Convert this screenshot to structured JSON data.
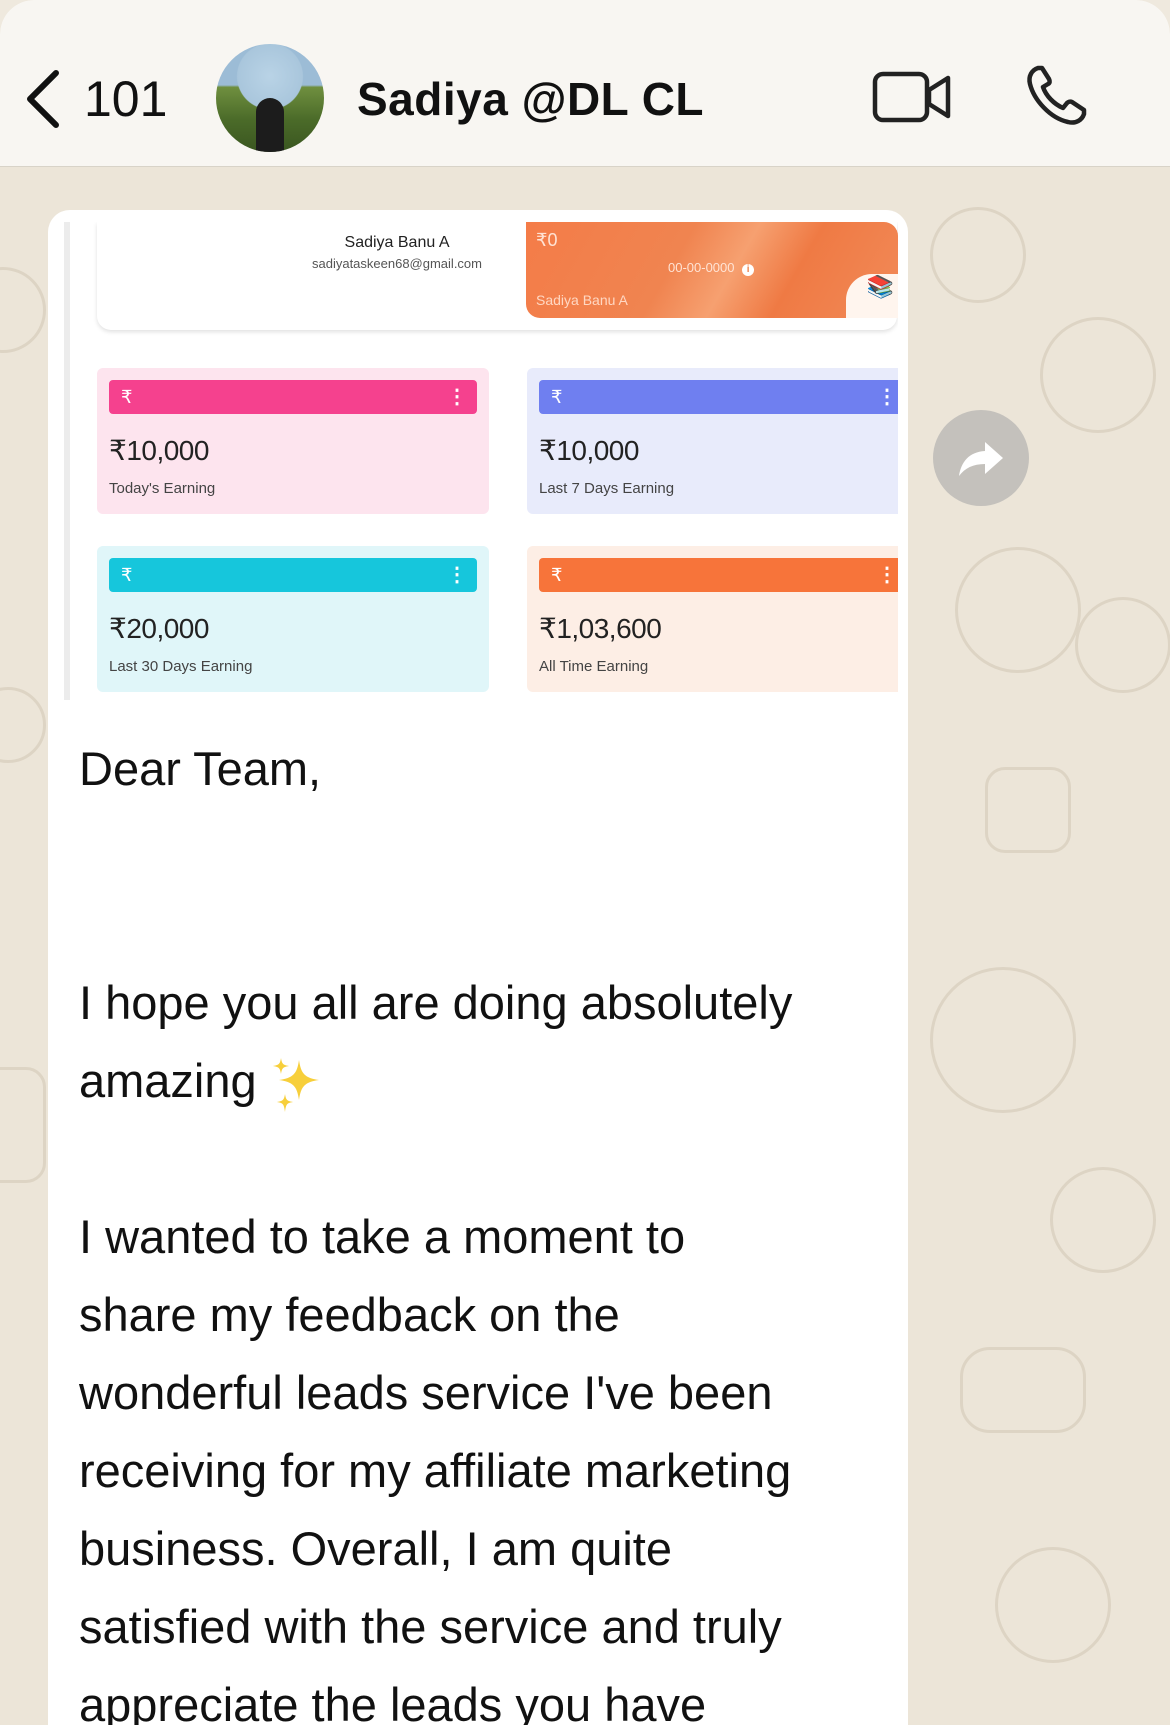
{
  "header": {
    "back_count": "101",
    "contact_name": "Sadiya @DL CL",
    "icons": [
      "chevron-left-icon",
      "video-call-icon",
      "phone-call-icon"
    ]
  },
  "attachment": {
    "profile": {
      "name": "Sadiya Banu A",
      "email": "sadiyataskeen68@gmail.com"
    },
    "wallet_card": {
      "amount": "₹0",
      "code": "00-00-0000",
      "holder": "Sadiya Banu A"
    },
    "stats": [
      {
        "symbol": "₹",
        "value": "₹10,000",
        "label": "Today's Earning",
        "bar_color": "#f5418e",
        "bg_color": "#fde4ee"
      },
      {
        "symbol": "₹",
        "value": "₹10,000",
        "label": "Last 7 Days Earning",
        "bar_color": "#6f7ff0",
        "bg_color": "#e8ebfb"
      },
      {
        "symbol": "₹",
        "value": "₹20,000",
        "label": "Last 30 Days Earning",
        "bar_color": "#16c6dc",
        "bg_color": "#e0f6f9"
      },
      {
        "symbol": "₹",
        "value": "₹1,03,600",
        "label": "All Time Earning",
        "bar_color": "#f7743a",
        "bg_color": "#fdeee5"
      }
    ]
  },
  "message": {
    "lines": [
      "Dear Team,",
      "",
      "",
      "I hope you all are doing absolutely",
      "amazing",
      "",
      "I wanted to take a moment to",
      "share my feedback on the",
      "wonderful leads service I've been",
      "receiving for my affiliate marketing",
      "business. Overall, I am quite",
      "satisfied with the service and truly",
      "appreciate the leads you have"
    ]
  }
}
